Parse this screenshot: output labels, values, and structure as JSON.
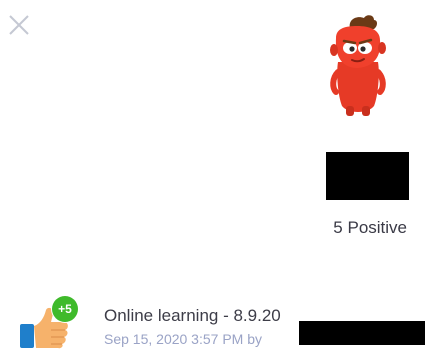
{
  "close": {
    "icon": "close-icon"
  },
  "student": {
    "avatar": "monster-avatar-icon",
    "avatar_color": "#f0402c"
  },
  "summary": {
    "points_text": "5 Positive"
  },
  "feedback": {
    "title": "Online learning - 8.9.20",
    "meta": "Sep 15, 2020 3:57 PM by",
    "badge": "+5",
    "badge_color": "#3fba2b",
    "icon": "thumbs-up-icon"
  }
}
